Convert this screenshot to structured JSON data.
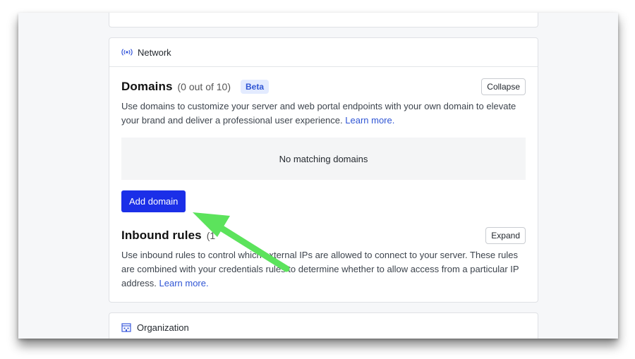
{
  "network": {
    "header_icon": "radio-waves-icon",
    "header_title": "Network",
    "domains": {
      "title": "Domains",
      "count": "(0 out of 10)",
      "badge": "Beta",
      "collapse_label": "Collapse",
      "description": "Use domains to customize your server and web portal endpoints with your own domain to elevate your brand and deliver a professional user experience.",
      "learn_more": "Learn more.",
      "empty_text": "No matching domains",
      "add_label": "Add domain"
    },
    "inbound": {
      "title": "Inbound rules",
      "count_partial": "(1",
      "expand_label": "Expand",
      "description": "Use inbound rules to control which external IPs are allowed to connect to your server. These rules are combined with your credentials rules to determine whether to allow access from a particular IP address.",
      "learn_more": "Learn more."
    }
  },
  "organization": {
    "header_icon": "building-icon",
    "header_title": "Organization"
  },
  "colors": {
    "primary_button": "#1b2fe8",
    "link": "#2f55d4",
    "beta_bg": "#e3ebff",
    "annotation_arrow": "#5ce35c"
  },
  "annotation": {
    "icon": "green-arrow-icon"
  }
}
